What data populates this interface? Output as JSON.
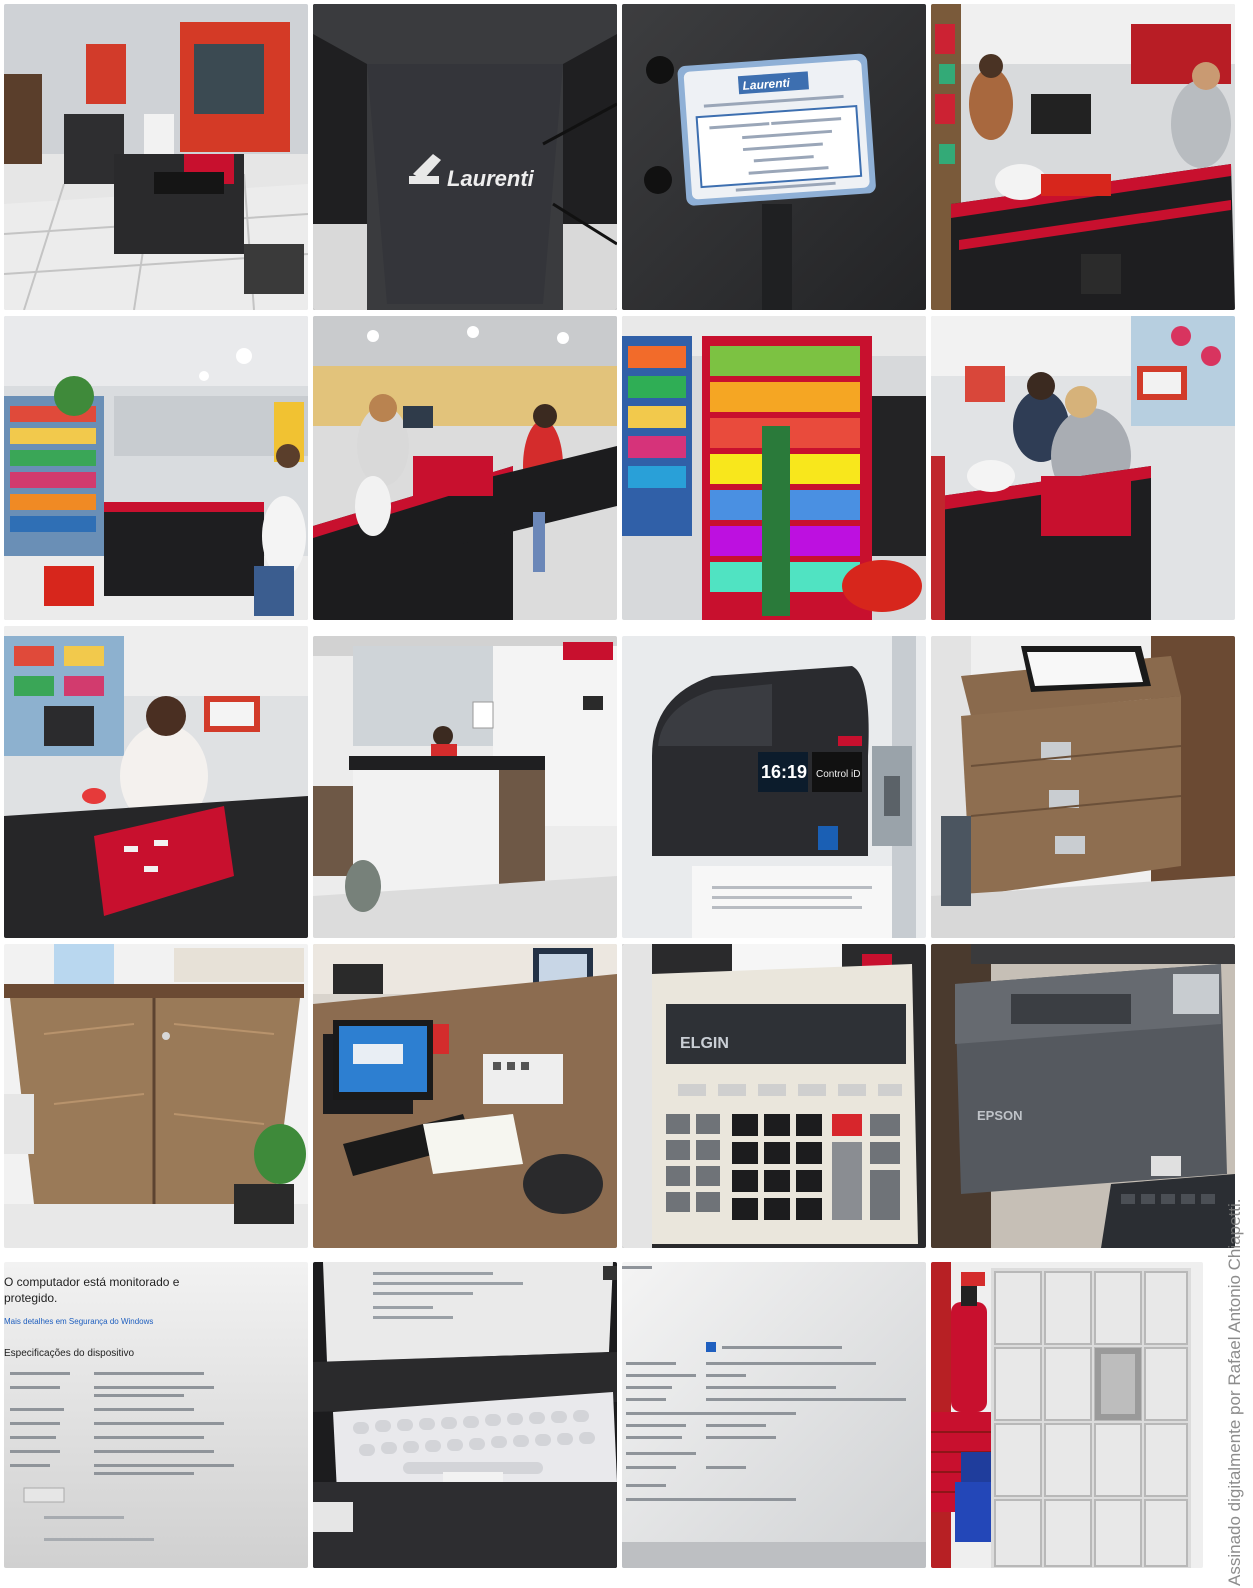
{
  "gallery": {
    "tiles": [
      {
        "name": "self-checkout-kiosk-photo"
      },
      {
        "name": "laurenti-stand-photo",
        "brand": "Laurenti"
      },
      {
        "name": "laurenti-label-photo",
        "brand": "Laurenti"
      },
      {
        "name": "checkout-lanes-photo-1"
      },
      {
        "name": "store-aisle-photo"
      },
      {
        "name": "checkout-lanes-photo-2"
      },
      {
        "name": "candy-rack-photo"
      },
      {
        "name": "cashier-station-photo"
      },
      {
        "name": "cashier-red-bags-photo"
      },
      {
        "name": "service-counter-photo"
      },
      {
        "name": "time-clock-photo",
        "clock_time": "16:19",
        "brand": "Control iD"
      },
      {
        "name": "drawer-cabinet-photo"
      },
      {
        "name": "wood-cabinet-photo"
      },
      {
        "name": "office-desk-photo"
      },
      {
        "name": "calculator-photo",
        "brand": "ELGIN"
      },
      {
        "name": "receipt-printer-photo",
        "brand": "EPSON"
      },
      {
        "name": "windows-security-screen-photo",
        "line1": "O computador está monitorado e",
        "line2": "protegido.",
        "link": "Mais detalhes em Segurança do Windows",
        "heading": "Especificações do dispositivo"
      },
      {
        "name": "monitor-keyboard-photo"
      },
      {
        "name": "windows-specs-screen-photo"
      },
      {
        "name": "lockers-extinguisher-photo"
      }
    ]
  },
  "signature": {
    "text": "Assinado digitalmente por Rafael Antonio Chiapetti."
  },
  "colors": {
    "store_red": "#c8102e",
    "counter_black": "#1c1c1e",
    "floor_tile": "#dedede",
    "wood": "#9a7a58"
  }
}
